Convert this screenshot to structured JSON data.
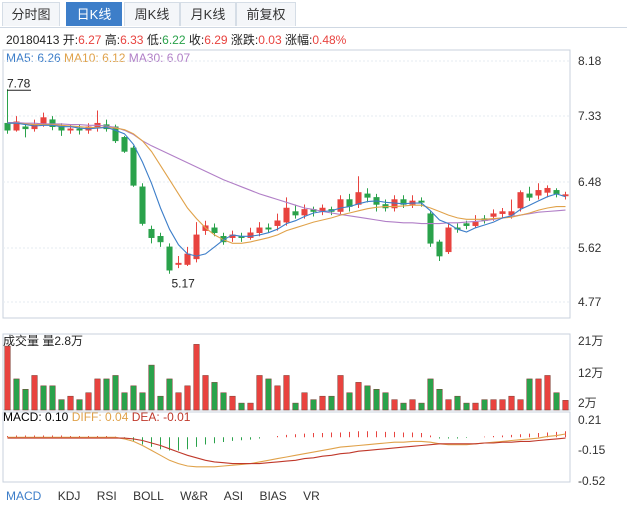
{
  "tabs": [
    "分时图",
    "日K线",
    "周K线",
    "月K线",
    "前复权"
  ],
  "active_tab": 1,
  "info": {
    "date": "20180413",
    "open_label": "开:",
    "open": "6.27",
    "high_label": "高:",
    "high": "6.33",
    "low_label": "低:",
    "low": "6.22",
    "close_label": "收:",
    "close": "6.29",
    "change_label": "涨跌:",
    "change": "0.03",
    "pct_label": "涨幅:",
    "pct": "0.48%"
  },
  "ma": {
    "ma5": "MA5: 6.26",
    "ma10": "MA10: 6.12",
    "ma30": "MA30: 6.07"
  },
  "volume_label": "成交量 量2.8万",
  "macd": {
    "macd": "MACD: 0.10",
    "diff": "DIFF: 0.04",
    "dea": "DEA: -0.01"
  },
  "bottom_tabs": [
    "MACD",
    "KDJ",
    "RSI",
    "BOLL",
    "W&R",
    "ASI",
    "BIAS",
    "VR"
  ],
  "colors": {
    "up": "#e8433f",
    "down": "#2aa24b",
    "ma5": "#3d7ec9",
    "ma10": "#e0a24a",
    "ma30": "#b17fc7",
    "active_tab": "#3d7ec9"
  },
  "chart_data": [
    {
      "type": "candlestick",
      "y_ticks": [
        "8.18",
        "7.33",
        "6.48",
        "5.62",
        "4.77"
      ],
      "ylim": [
        4.77,
        8.18
      ],
      "annotations": [
        {
          "text": "7.78",
          "value": 7.78
        },
        {
          "text": "5.17",
          "value": 5.17
        }
      ],
      "candles": [
        {
          "o": 7.3,
          "c": 7.2,
          "h": 7.78,
          "l": 7.15
        },
        {
          "o": 7.2,
          "c": 7.32,
          "h": 7.4,
          "l": 7.18
        },
        {
          "o": 7.25,
          "c": 7.22,
          "h": 7.3,
          "l": 7.1
        },
        {
          "o": 7.22,
          "c": 7.28,
          "h": 7.35,
          "l": 7.18
        },
        {
          "o": 7.3,
          "c": 7.38,
          "h": 7.45,
          "l": 7.25
        },
        {
          "o": 7.35,
          "c": 7.25,
          "h": 7.4,
          "l": 7.2
        },
        {
          "o": 7.26,
          "c": 7.2,
          "h": 7.3,
          "l": 7.12
        },
        {
          "o": 7.2,
          "c": 7.22,
          "h": 7.28,
          "l": 7.15
        },
        {
          "o": 7.22,
          "c": 7.2,
          "h": 7.28,
          "l": 7.14
        },
        {
          "o": 7.2,
          "c": 7.25,
          "h": 7.3,
          "l": 7.15
        },
        {
          "o": 7.25,
          "c": 7.3,
          "h": 7.48,
          "l": 7.18
        },
        {
          "o": 7.28,
          "c": 7.22,
          "h": 7.35,
          "l": 7.18
        },
        {
          "o": 7.25,
          "c": 7.05,
          "h": 7.28,
          "l": 7.02
        },
        {
          "o": 7.1,
          "c": 6.9,
          "h": 7.12,
          "l": 6.88
        },
        {
          "o": 6.95,
          "c": 6.42,
          "h": 6.98,
          "l": 6.4
        },
        {
          "o": 6.4,
          "c": 5.88,
          "h": 6.45,
          "l": 5.85
        },
        {
          "o": 5.8,
          "c": 5.68,
          "h": 5.85,
          "l": 5.6
        },
        {
          "o": 5.7,
          "c": 5.62,
          "h": 5.75,
          "l": 5.55
        },
        {
          "o": 5.55,
          "c": 5.22,
          "h": 5.6,
          "l": 5.17
        },
        {
          "o": 5.3,
          "c": 5.32,
          "h": 5.42,
          "l": 5.25
        },
        {
          "o": 5.3,
          "c": 5.45,
          "h": 5.55,
          "l": 5.28
        },
        {
          "o": 5.38,
          "c": 5.72,
          "h": 5.9,
          "l": 5.33
        },
        {
          "o": 5.78,
          "c": 5.85,
          "h": 5.92,
          "l": 5.72
        },
        {
          "o": 5.82,
          "c": 5.75,
          "h": 5.88,
          "l": 5.7
        },
        {
          "o": 5.7,
          "c": 5.62,
          "h": 5.75,
          "l": 5.58
        },
        {
          "o": 5.68,
          "c": 5.72,
          "h": 5.78,
          "l": 5.62
        },
        {
          "o": 5.7,
          "c": 5.68,
          "h": 5.75,
          "l": 5.62
        },
        {
          "o": 5.68,
          "c": 5.75,
          "h": 5.82,
          "l": 5.65
        },
        {
          "o": 5.75,
          "c": 5.82,
          "h": 5.9,
          "l": 5.7
        },
        {
          "o": 5.82,
          "c": 5.8,
          "h": 5.88,
          "l": 5.75
        },
        {
          "o": 5.85,
          "c": 5.92,
          "h": 6.02,
          "l": 5.78
        },
        {
          "o": 5.9,
          "c": 6.1,
          "h": 6.25,
          "l": 5.85
        },
        {
          "o": 6.05,
          "c": 6.0,
          "h": 6.15,
          "l": 5.95
        },
        {
          "o": 6.0,
          "c": 6.08,
          "h": 6.15,
          "l": 5.95
        },
        {
          "o": 6.08,
          "c": 6.05,
          "h": 6.12,
          "l": 5.98
        },
        {
          "o": 6.05,
          "c": 6.1,
          "h": 6.15,
          "l": 6.0
        },
        {
          "o": 6.08,
          "c": 6.05,
          "h": 6.12,
          "l": 6.0
        },
        {
          "o": 6.05,
          "c": 6.22,
          "h": 6.28,
          "l": 6.0
        },
        {
          "o": 6.22,
          "c": 6.12,
          "h": 6.3,
          "l": 6.05
        },
        {
          "o": 6.15,
          "c": 6.32,
          "h": 6.55,
          "l": 6.1
        },
        {
          "o": 6.3,
          "c": 6.25,
          "h": 6.38,
          "l": 6.18
        },
        {
          "o": 6.25,
          "c": 6.15,
          "h": 6.3,
          "l": 6.05
        },
        {
          "o": 6.15,
          "c": 6.1,
          "h": 6.22,
          "l": 6.05
        },
        {
          "o": 6.1,
          "c": 6.22,
          "h": 6.28,
          "l": 6.05
        },
        {
          "o": 6.22,
          "c": 6.15,
          "h": 6.28,
          "l": 6.1
        },
        {
          "o": 6.15,
          "c": 6.2,
          "h": 6.28,
          "l": 6.1
        },
        {
          "o": 6.2,
          "c": 6.18,
          "h": 6.25,
          "l": 6.12
        },
        {
          "o": 6.02,
          "c": 5.6,
          "h": 6.05,
          "l": 5.55
        },
        {
          "o": 5.62,
          "c": 5.42,
          "h": 5.65,
          "l": 5.35
        },
        {
          "o": 5.48,
          "c": 5.82,
          "h": 5.88,
          "l": 5.45
        },
        {
          "o": 5.82,
          "c": 5.8,
          "h": 5.88,
          "l": 5.75
        },
        {
          "o": 5.88,
          "c": 5.85,
          "h": 5.92,
          "l": 5.8
        },
        {
          "o": 5.85,
          "c": 5.9,
          "h": 6.0,
          "l": 5.82
        },
        {
          "o": 5.95,
          "c": 5.92,
          "h": 6.0,
          "l": 5.88
        },
        {
          "o": 5.98,
          "c": 6.02,
          "h": 6.08,
          "l": 5.92
        },
        {
          "o": 6.02,
          "c": 6.05,
          "h": 6.1,
          "l": 5.95
        },
        {
          "o": 6.0,
          "c": 6.05,
          "h": 6.22,
          "l": 5.95
        },
        {
          "o": 6.1,
          "c": 6.32,
          "h": 6.35,
          "l": 6.05
        },
        {
          "o": 6.3,
          "c": 6.25,
          "h": 6.4,
          "l": 6.2
        },
        {
          "o": 6.28,
          "c": 6.35,
          "h": 6.45,
          "l": 6.22
        },
        {
          "o": 6.32,
          "c": 6.38,
          "h": 6.42,
          "l": 6.25
        },
        {
          "o": 6.35,
          "c": 6.3,
          "h": 6.38,
          "l": 6.25
        },
        {
          "o": 6.27,
          "c": 6.29,
          "h": 6.33,
          "l": 6.22
        }
      ],
      "ma5": [
        7.3,
        7.3,
        7.28,
        7.26,
        7.27,
        7.27,
        7.25,
        7.25,
        7.23,
        7.22,
        7.23,
        7.24,
        7.2,
        7.15,
        7.0,
        6.75,
        6.45,
        6.1,
        5.8,
        5.58,
        5.45,
        5.42,
        5.45,
        5.55,
        5.65,
        5.72,
        5.7,
        5.7,
        5.72,
        5.75,
        5.8,
        5.88,
        5.92,
        5.98,
        6.03,
        6.05,
        6.06,
        6.1,
        6.12,
        6.16,
        6.19,
        6.2,
        6.18,
        6.17,
        6.16,
        6.17,
        6.17,
        6.06,
        5.93,
        5.88,
        5.8,
        5.76,
        5.82,
        5.86,
        5.9,
        5.96,
        5.99,
        6.08,
        6.14,
        6.2,
        6.26,
        6.3,
        6.26
      ],
      "ma10": [
        7.3,
        7.3,
        7.29,
        7.28,
        7.28,
        7.28,
        7.27,
        7.26,
        7.25,
        7.24,
        7.24,
        7.24,
        7.23,
        7.21,
        7.15,
        7.05,
        6.9,
        6.7,
        6.5,
        6.3,
        6.1,
        5.95,
        5.82,
        5.72,
        5.65,
        5.6,
        5.6,
        5.62,
        5.65,
        5.68,
        5.72,
        5.78,
        5.82,
        5.86,
        5.9,
        5.93,
        5.96,
        6.0,
        6.03,
        6.06,
        6.09,
        6.11,
        6.12,
        6.12,
        6.13,
        6.14,
        6.14,
        6.1,
        6.05,
        6.0,
        5.96,
        5.94,
        5.94,
        5.94,
        5.95,
        5.96,
        5.97,
        6.0,
        6.03,
        6.07,
        6.1,
        6.12,
        6.12
      ],
      "ma30": [
        7.31,
        7.31,
        7.3,
        7.3,
        7.29,
        7.29,
        7.29,
        7.28,
        7.28,
        7.27,
        7.27,
        7.26,
        7.24,
        7.2,
        7.14,
        7.05,
        6.98,
        6.92,
        6.86,
        6.8,
        6.74,
        6.68,
        6.62,
        6.56,
        6.5,
        6.45,
        6.4,
        6.35,
        6.3,
        6.26,
        6.22,
        6.18,
        6.14,
        6.1,
        6.08,
        6.05,
        6.03,
        6.01,
        5.99,
        5.97,
        5.95,
        5.93,
        5.91,
        5.9,
        5.89,
        5.89,
        5.88,
        5.88,
        5.88,
        5.89,
        5.89,
        5.9,
        5.91,
        5.92,
        5.94,
        5.96,
        5.98,
        6.0,
        6.02,
        6.04,
        6.05,
        6.06,
        6.07
      ]
    },
    {
      "type": "bar",
      "label": "成交量 量2.8万",
      "y_ticks": [
        "21万",
        "12万",
        "2万"
      ],
      "ylim": [
        0,
        22
      ],
      "values": [
        18.5,
        9,
        6,
        10,
        7,
        7,
        3,
        4,
        3,
        5,
        9,
        9,
        10,
        5,
        7,
        5,
        13,
        4,
        9,
        5,
        7,
        19,
        10,
        8,
        5,
        4,
        2,
        2,
        10,
        9,
        7,
        10,
        2,
        5,
        3,
        4,
        4,
        10,
        5,
        8,
        7,
        6,
        5,
        3,
        2,
        3,
        2,
        9,
        6,
        3,
        4,
        2,
        2,
        3,
        3,
        3,
        4,
        3,
        9,
        9,
        10,
        5,
        2.8
      ],
      "up_or_down": [
        1,
        0,
        0,
        1,
        0,
        0,
        0,
        1,
        0,
        1,
        1,
        0,
        0,
        0,
        0,
        0,
        0,
        0,
        0,
        1,
        1,
        1,
        1,
        0,
        0,
        1,
        0,
        1,
        1,
        0,
        1,
        1,
        0,
        1,
        0,
        1,
        0,
        1,
        0,
        1,
        0,
        0,
        0,
        1,
        0,
        1,
        0,
        0,
        0,
        1,
        0,
        0,
        1,
        0,
        1,
        1,
        1,
        1,
        0,
        1,
        1,
        0,
        1
      ]
    },
    {
      "type": "bar",
      "label": "MACD",
      "y_ticks": [
        "0.21",
        "-0.15",
        "-0.52"
      ],
      "ylim": [
        -0.52,
        0.21
      ],
      "macd": [
        0.02,
        0.03,
        0.03,
        0.03,
        0.03,
        0.03,
        0.03,
        0.02,
        0.02,
        0.02,
        0.02,
        0.02,
        0.01,
        -0.02,
        -0.06,
        -0.12,
        -0.16,
        -0.2,
        -0.22,
        -0.22,
        -0.2,
        -0.16,
        -0.12,
        -0.1,
        -0.08,
        -0.06,
        -0.05,
        -0.04,
        -0.02,
        0.0,
        0.02,
        0.04,
        0.05,
        0.06,
        0.07,
        0.07,
        0.08,
        0.08,
        0.09,
        0.1,
        0.1,
        0.1,
        0.09,
        0.09,
        0.08,
        0.08,
        0.07,
        0.03,
        -0.02,
        -0.02,
        -0.02,
        -0.01,
        0.0,
        0.01,
        0.02,
        0.03,
        0.04,
        0.05,
        0.06,
        0.07,
        0.08,
        0.09,
        0.1
      ],
      "diff": [
        0.0,
        0.0,
        0.0,
        0.0,
        0.0,
        0.0,
        0.0,
        0.0,
        0.0,
        0.0,
        0.0,
        0.0,
        0.0,
        -0.02,
        -0.05,
        -0.1,
        -0.16,
        -0.22,
        -0.28,
        -0.32,
        -0.35,
        -0.36,
        -0.36,
        -0.36,
        -0.35,
        -0.34,
        -0.33,
        -0.32,
        -0.3,
        -0.28,
        -0.26,
        -0.24,
        -0.22,
        -0.2,
        -0.18,
        -0.16,
        -0.14,
        -0.12,
        -0.11,
        -0.1,
        -0.09,
        -0.08,
        -0.07,
        -0.06,
        -0.06,
        -0.05,
        -0.05,
        -0.06,
        -0.08,
        -0.09,
        -0.09,
        -0.09,
        -0.08,
        -0.07,
        -0.06,
        -0.05,
        -0.04,
        -0.03,
        -0.02,
        -0.01,
        0.01,
        0.02,
        0.04
      ],
      "dea": [
        -0.01,
        -0.01,
        -0.01,
        -0.01,
        -0.01,
        -0.01,
        -0.01,
        -0.01,
        -0.01,
        -0.01,
        -0.01,
        -0.01,
        -0.01,
        -0.01,
        -0.02,
        -0.04,
        -0.07,
        -0.1,
        -0.14,
        -0.18,
        -0.22,
        -0.25,
        -0.28,
        -0.3,
        -0.31,
        -0.32,
        -0.32,
        -0.32,
        -0.32,
        -0.31,
        -0.3,
        -0.29,
        -0.28,
        -0.26,
        -0.25,
        -0.23,
        -0.22,
        -0.2,
        -0.19,
        -0.17,
        -0.16,
        -0.15,
        -0.14,
        -0.13,
        -0.12,
        -0.11,
        -0.1,
        -0.09,
        -0.08,
        -0.08,
        -0.08,
        -0.08,
        -0.08,
        -0.07,
        -0.07,
        -0.06,
        -0.06,
        -0.05,
        -0.05,
        -0.04,
        -0.03,
        -0.02,
        -0.01
      ]
    }
  ]
}
